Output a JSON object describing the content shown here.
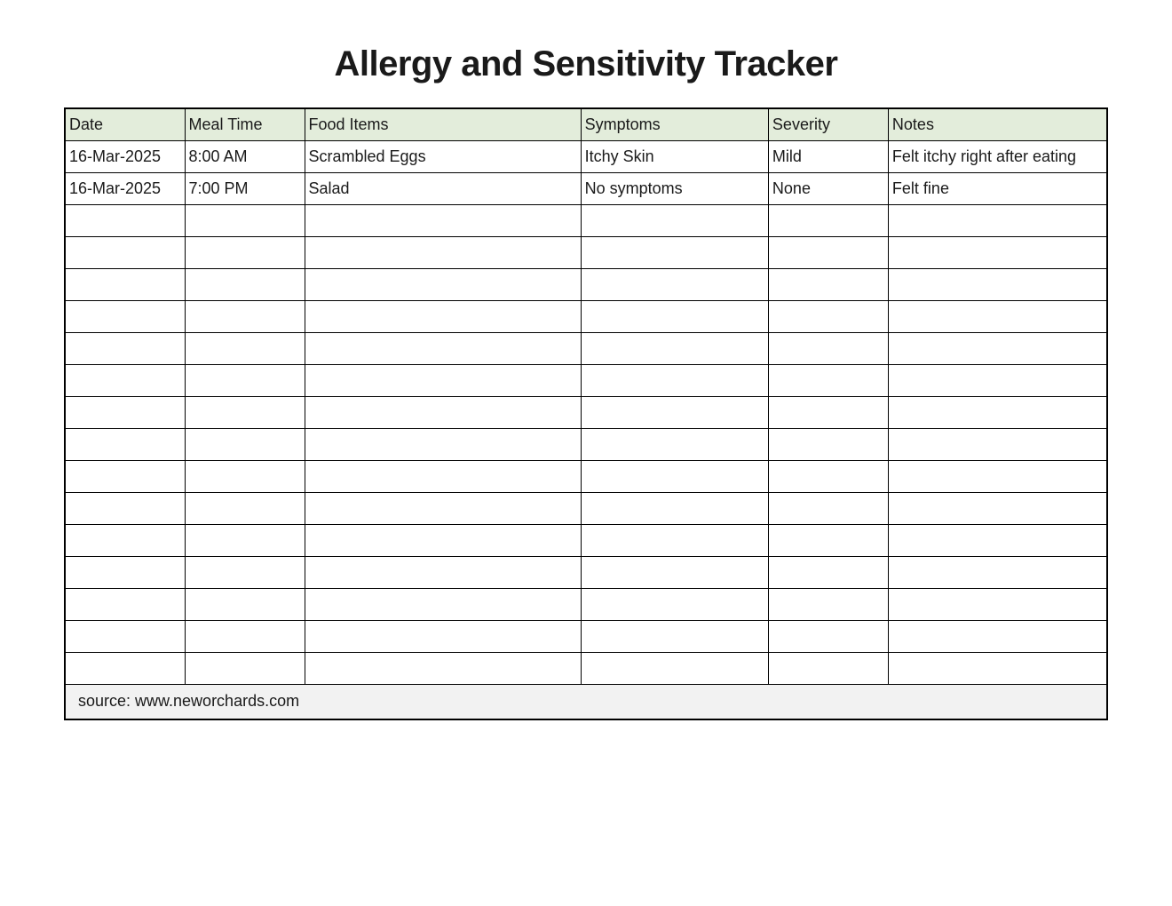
{
  "title": "Allergy and Sensitivity Tracker",
  "columns": {
    "date": "Date",
    "meal": "Meal Time",
    "food": "Food Items",
    "symp": "Symptoms",
    "sev": "Severity",
    "notes": "Notes"
  },
  "rows": [
    {
      "date": "16-Mar-2025",
      "meal": "8:00 AM",
      "food": "Scrambled Eggs",
      "symp": "Itchy Skin",
      "sev": "Mild",
      "notes": "Felt itchy right after eating"
    },
    {
      "date": "16-Mar-2025",
      "meal": "7:00 PM",
      "food": "Salad",
      "symp": "No symptoms",
      "sev": "None",
      "notes": "Felt fine"
    },
    {
      "date": "",
      "meal": "",
      "food": "",
      "symp": "",
      "sev": "",
      "notes": ""
    },
    {
      "date": "",
      "meal": "",
      "food": "",
      "symp": "",
      "sev": "",
      "notes": ""
    },
    {
      "date": "",
      "meal": "",
      "food": "",
      "symp": "",
      "sev": "",
      "notes": ""
    },
    {
      "date": "",
      "meal": "",
      "food": "",
      "symp": "",
      "sev": "",
      "notes": ""
    },
    {
      "date": "",
      "meal": "",
      "food": "",
      "symp": "",
      "sev": "",
      "notes": ""
    },
    {
      "date": "",
      "meal": "",
      "food": "",
      "symp": "",
      "sev": "",
      "notes": ""
    },
    {
      "date": "",
      "meal": "",
      "food": "",
      "symp": "",
      "sev": "",
      "notes": ""
    },
    {
      "date": "",
      "meal": "",
      "food": "",
      "symp": "",
      "sev": "",
      "notes": ""
    },
    {
      "date": "",
      "meal": "",
      "food": "",
      "symp": "",
      "sev": "",
      "notes": ""
    },
    {
      "date": "",
      "meal": "",
      "food": "",
      "symp": "",
      "sev": "",
      "notes": ""
    },
    {
      "date": "",
      "meal": "",
      "food": "",
      "symp": "",
      "sev": "",
      "notes": ""
    },
    {
      "date": "",
      "meal": "",
      "food": "",
      "symp": "",
      "sev": "",
      "notes": ""
    },
    {
      "date": "",
      "meal": "",
      "food": "",
      "symp": "",
      "sev": "",
      "notes": ""
    },
    {
      "date": "",
      "meal": "",
      "food": "",
      "symp": "",
      "sev": "",
      "notes": ""
    },
    {
      "date": "",
      "meal": "",
      "food": "",
      "symp": "",
      "sev": "",
      "notes": ""
    }
  ],
  "footer": "source: www.neworchards.com"
}
